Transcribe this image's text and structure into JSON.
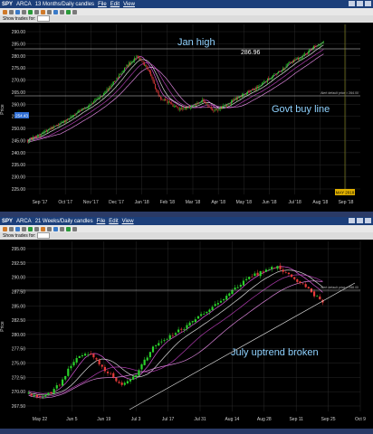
{
  "panels": [
    {
      "symbol": "SPY",
      "symbol_sub": "ARCA",
      "title": "13 Months/Daily candles",
      "menus": [
        "File",
        "Edit",
        "View"
      ],
      "show_trades_label": "Show trades for:",
      "price_axis_label": "Price",
      "y_ticks": [
        "290.00",
        "285.00",
        "280.00",
        "275.00",
        "270.00",
        "265.00",
        "260.00",
        "255.00",
        "250.00",
        "245.00",
        "240.00",
        "235.00",
        "230.00",
        "225.00"
      ],
      "x_ticks": [
        "Sep '17",
        "Oct '17",
        "Nov '17",
        "Dec '17",
        "Jan '18",
        "Feb '18",
        "Mar '18",
        "Apr '18",
        "May '18",
        "Jun '18",
        "Jul '18",
        "Aug '18",
        "Sep '18"
      ],
      "current_price_tag": "254.43",
      "date_tag": "MAY 2018",
      "annotations": {
        "jan_high": "Jan high",
        "level": "286.96",
        "govt_line": "Govt buy line",
        "alert": "Alert default price ≈ 264.00"
      }
    },
    {
      "symbol": "SPY",
      "symbol_sub": "ARCA",
      "title": "21 Weeks/Daily candles",
      "menus": [
        "File",
        "Edit",
        "View"
      ],
      "show_trades_label": "Show trades for:",
      "price_axis_label": "Price",
      "y_ticks": [
        "295.00",
        "292.50",
        "290.00",
        "287.50",
        "285.00",
        "282.50",
        "280.00",
        "277.50",
        "275.00",
        "272.50",
        "270.00",
        "267.50"
      ],
      "x_ticks": [
        "May 22",
        "Jun 5",
        "Jun 19",
        "Jul 3",
        "Jul 17",
        "Jul 31",
        "Aug 14",
        "Aug 28",
        "Sep 11",
        "Sep 25",
        "Oct 9"
      ],
      "annotations": {
        "uptrend": "July uptrend broken",
        "alert": "Alert default price ≈ 288.00"
      }
    }
  ],
  "colors": {
    "background": "#000000",
    "candle_up": "#2bd12b",
    "candle_down": "#e83a3a",
    "ma_colors": [
      "#ff66ff",
      "#ffffff",
      "#cc44cc",
      "#ff99ff"
    ],
    "annotation_text": "#8fd2ff",
    "title_bar": "#1c3f7a"
  }
}
